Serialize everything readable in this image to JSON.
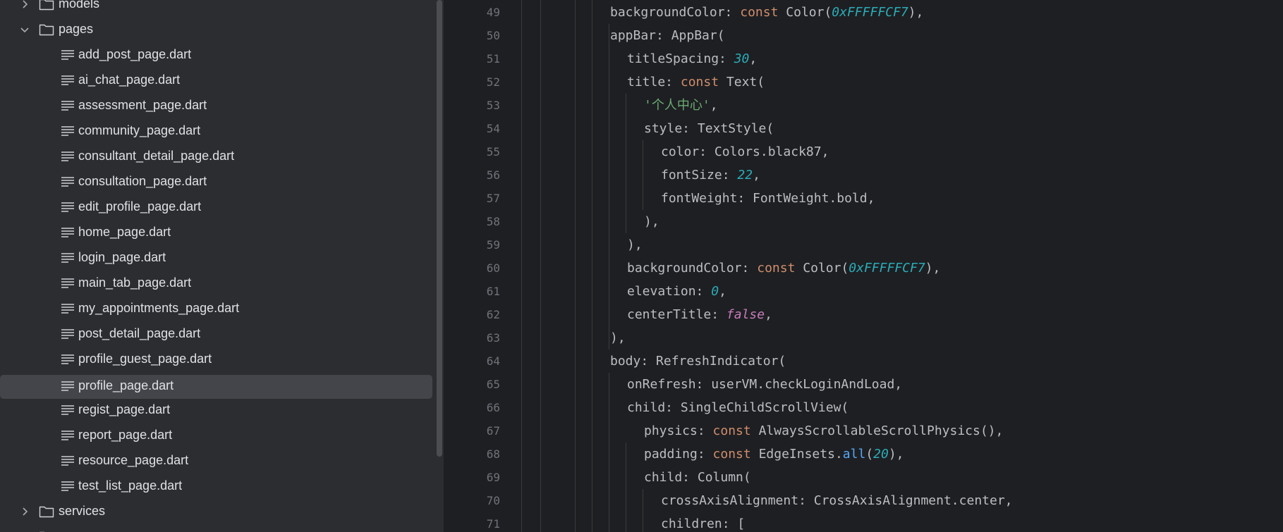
{
  "project_tree": {
    "rows": [
      {
        "label": "models",
        "kind": "folder",
        "expanded": false,
        "depth": 0
      },
      {
        "label": "pages",
        "kind": "folder",
        "expanded": true,
        "depth": 0
      },
      {
        "label": "add_post_page.dart",
        "kind": "file",
        "depth": 1
      },
      {
        "label": "ai_chat_page.dart",
        "kind": "file",
        "depth": 1
      },
      {
        "label": "assessment_page.dart",
        "kind": "file",
        "depth": 1
      },
      {
        "label": "community_page.dart",
        "kind": "file",
        "depth": 1
      },
      {
        "label": "consultant_detail_page.dart",
        "kind": "file",
        "depth": 1
      },
      {
        "label": "consultation_page.dart",
        "kind": "file",
        "depth": 1
      },
      {
        "label": "edit_profile_page.dart",
        "kind": "file",
        "depth": 1
      },
      {
        "label": "home_page.dart",
        "kind": "file",
        "depth": 1
      },
      {
        "label": "login_page.dart",
        "kind": "file",
        "depth": 1
      },
      {
        "label": "main_tab_page.dart",
        "kind": "file",
        "depth": 1
      },
      {
        "label": "my_appointments_page.dart",
        "kind": "file",
        "depth": 1
      },
      {
        "label": "post_detail_page.dart",
        "kind": "file",
        "depth": 1
      },
      {
        "label": "profile_guest_page.dart",
        "kind": "file",
        "depth": 1
      },
      {
        "label": "profile_page.dart",
        "kind": "file",
        "depth": 1,
        "selected": true
      },
      {
        "label": "regist_page.dart",
        "kind": "file",
        "depth": 1
      },
      {
        "label": "report_page.dart",
        "kind": "file",
        "depth": 1
      },
      {
        "label": "resource_page.dart",
        "kind": "file",
        "depth": 1
      },
      {
        "label": "test_list_page.dart",
        "kind": "file",
        "depth": 1
      },
      {
        "label": "services",
        "kind": "folder",
        "expanded": false,
        "depth": 0
      },
      {
        "label": "",
        "kind": "folder",
        "expanded": false,
        "depth": 0
      }
    ]
  },
  "editor": {
    "lines": [
      {
        "number": "49",
        "indent": 3,
        "tokens": [
          [
            "plain",
            "backgroundColor: "
          ],
          [
            "kw",
            "const "
          ],
          [
            "plain",
            "Color("
          ],
          [
            "num",
            "0xFFFFFCF7"
          ],
          [
            "plain",
            "),"
          ]
        ]
      },
      {
        "number": "50",
        "indent": 3,
        "tokens": [
          [
            "plain",
            "appBar: AppBar("
          ]
        ]
      },
      {
        "number": "51",
        "indent": 4,
        "tokens": [
          [
            "plain",
            "titleSpacing: "
          ],
          [
            "num",
            "30"
          ],
          [
            "plain",
            ","
          ]
        ]
      },
      {
        "number": "52",
        "indent": 4,
        "tokens": [
          [
            "plain",
            "title: "
          ],
          [
            "kw",
            "const "
          ],
          [
            "plain",
            "Text("
          ]
        ]
      },
      {
        "number": "53",
        "indent": 5,
        "tokens": [
          [
            "str",
            "'个人中心'"
          ],
          [
            "plain",
            ","
          ]
        ]
      },
      {
        "number": "54",
        "indent": 5,
        "tokens": [
          [
            "plain",
            "style: TextStyle("
          ]
        ]
      },
      {
        "number": "55",
        "indent": 6,
        "tokens": [
          [
            "plain",
            "color: Colors.black87,"
          ]
        ]
      },
      {
        "number": "56",
        "indent": 6,
        "tokens": [
          [
            "plain",
            "fontSize: "
          ],
          [
            "num",
            "22"
          ],
          [
            "plain",
            ","
          ]
        ]
      },
      {
        "number": "57",
        "indent": 6,
        "tokens": [
          [
            "plain",
            "fontWeight: FontWeight.bold,"
          ]
        ]
      },
      {
        "number": "58",
        "indent": 5,
        "tokens": [
          [
            "plain",
            "),"
          ]
        ]
      },
      {
        "number": "59",
        "indent": 4,
        "tokens": [
          [
            "plain",
            "),"
          ]
        ]
      },
      {
        "number": "60",
        "indent": 4,
        "tokens": [
          [
            "plain",
            "backgroundColor: "
          ],
          [
            "kw",
            "const "
          ],
          [
            "plain",
            "Color("
          ],
          [
            "num",
            "0xFFFFFCF7"
          ],
          [
            "plain",
            "),"
          ]
        ]
      },
      {
        "number": "61",
        "indent": 4,
        "tokens": [
          [
            "plain",
            "elevation: "
          ],
          [
            "num",
            "0"
          ],
          [
            "plain",
            ","
          ]
        ]
      },
      {
        "number": "62",
        "indent": 4,
        "tokens": [
          [
            "plain",
            "centerTitle: "
          ],
          [
            "bool",
            "false"
          ],
          [
            "plain",
            ","
          ]
        ]
      },
      {
        "number": "63",
        "indent": 3,
        "tokens": [
          [
            "plain",
            "),"
          ]
        ]
      },
      {
        "number": "64",
        "indent": 3,
        "tokens": [
          [
            "plain",
            "body: RefreshIndicator("
          ]
        ]
      },
      {
        "number": "65",
        "indent": 4,
        "tokens": [
          [
            "plain",
            "onRefresh: userVM.checkLoginAndLoad,"
          ]
        ]
      },
      {
        "number": "66",
        "indent": 4,
        "tokens": [
          [
            "plain",
            "child: SingleChildScrollView("
          ]
        ]
      },
      {
        "number": "67",
        "indent": 5,
        "tokens": [
          [
            "plain",
            "physics: "
          ],
          [
            "kw",
            "const "
          ],
          [
            "plain",
            "AlwaysScrollableScrollPhysics(),"
          ]
        ]
      },
      {
        "number": "68",
        "indent": 5,
        "tokens": [
          [
            "plain",
            "padding: "
          ],
          [
            "kw",
            "const "
          ],
          [
            "plain",
            "EdgeInsets."
          ],
          [
            "fn",
            "all"
          ],
          [
            "plain",
            "("
          ],
          [
            "num",
            "20"
          ],
          [
            "plain",
            "),"
          ]
        ]
      },
      {
        "number": "69",
        "indent": 5,
        "tokens": [
          [
            "plain",
            "child: Column("
          ]
        ]
      },
      {
        "number": "70",
        "indent": 6,
        "tokens": [
          [
            "plain",
            "crossAxisAlignment: CrossAxisAlignment.center,"
          ]
        ]
      },
      {
        "number": "71",
        "indent": 6,
        "tokens": [
          [
            "plain",
            "children: ["
          ]
        ]
      }
    ]
  },
  "colors": {
    "tree_bg": "#2b2d30",
    "editor_bg": "#1e1f22",
    "selection": "#43454a",
    "keyword": "#cf8e6d",
    "number": "#2aacb8",
    "string": "#6aab73",
    "boolean": "#c77dbb",
    "function": "#56a8f5"
  }
}
